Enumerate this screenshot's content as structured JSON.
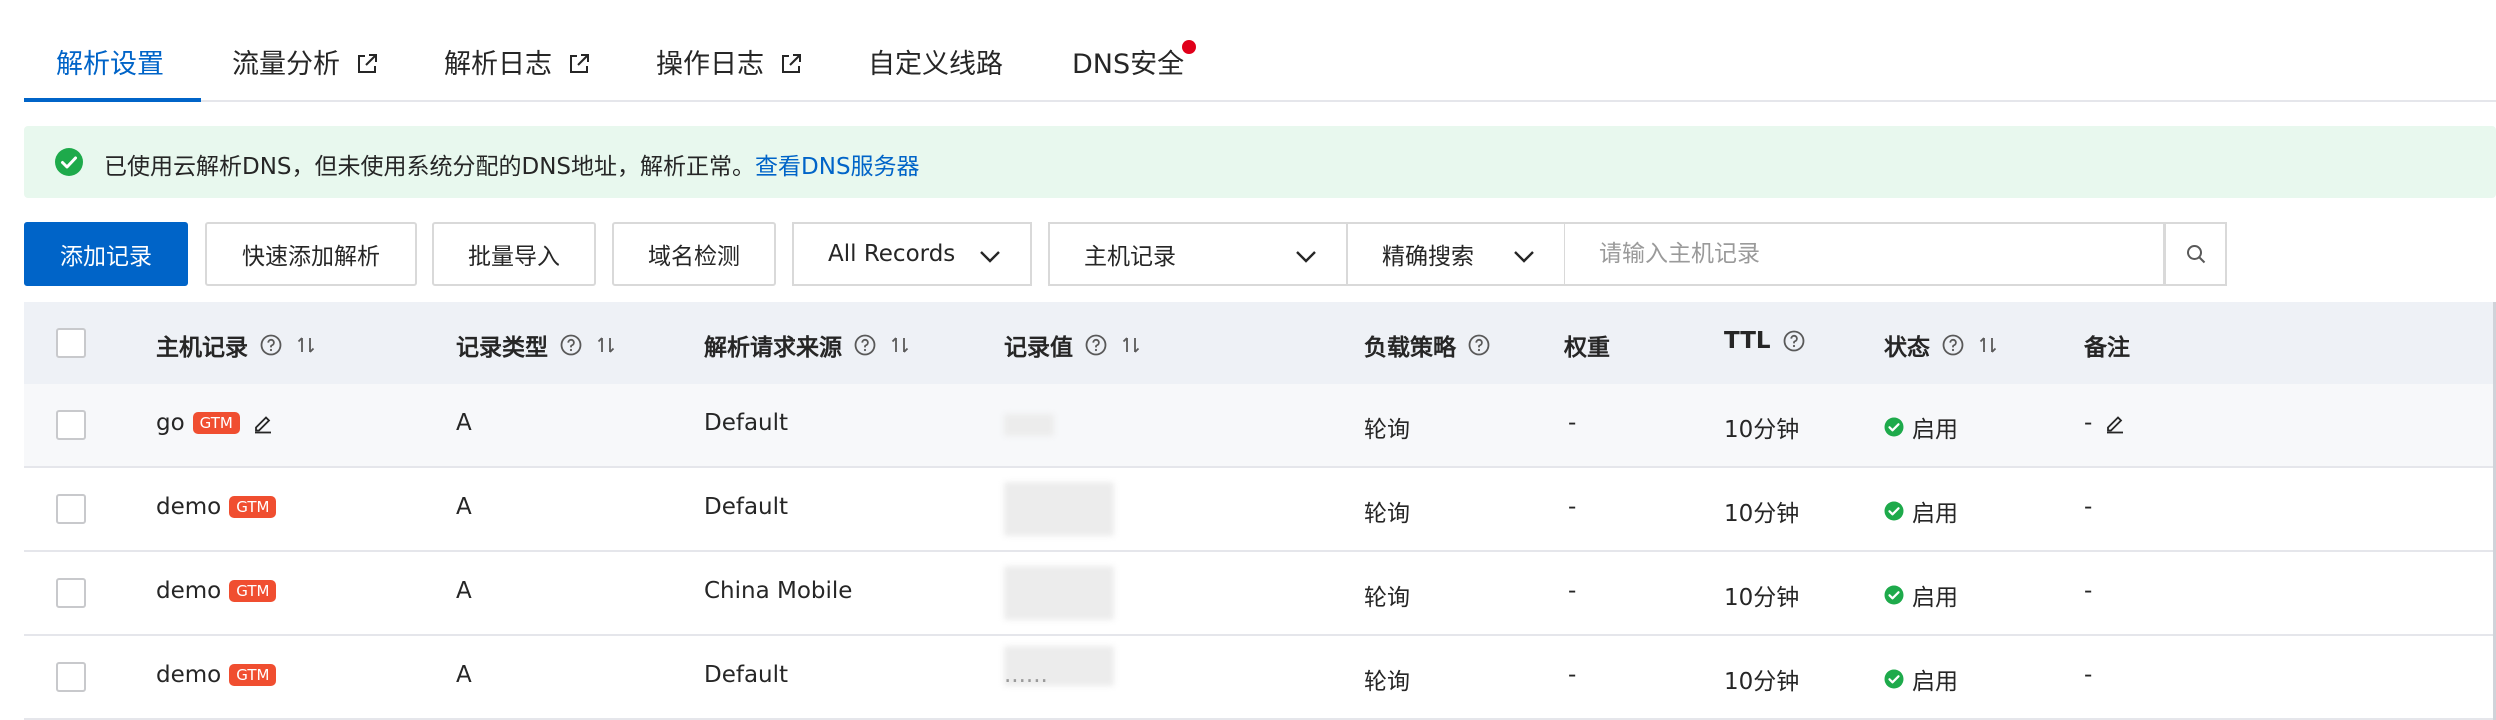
{
  "tabs": [
    {
      "label": "解析设置"
    },
    {
      "label": "流量分析"
    },
    {
      "label": "解析日志"
    },
    {
      "label": "操作日志"
    },
    {
      "label": "自定义线路"
    },
    {
      "label": "DNS安全"
    }
  ],
  "alert": {
    "text": "已使用云解析DNS，但未使用系统分配的DNS地址，解析正常。",
    "link": "查看DNS服务器"
  },
  "toolbar": {
    "add_record": "添加记录",
    "quick_add": "快速添加解析",
    "batch_import": "批量导入",
    "domain_check": "域名检测",
    "record_filter": "All Records",
    "search_field": "主机记录",
    "search_mode": "精确搜索",
    "search_placeholder": "请输入主机记录"
  },
  "table": {
    "headers": {
      "host": "主机记录",
      "type": "记录类型",
      "source": "解析请求来源",
      "value": "记录值",
      "policy": "负载策略",
      "weight": "权重",
      "ttl": "TTL",
      "status": "状态",
      "remark": "备注"
    },
    "gtm_badge": "GTM",
    "rows": [
      {
        "host": "go",
        "type": "A",
        "source": "Default",
        "value": "",
        "policy": "轮询",
        "weight": "-",
        "ttl": "10分钟",
        "status": "启用",
        "remark": "-"
      },
      {
        "host": "demo",
        "type": "A",
        "source": "Default",
        "value": "",
        "policy": "轮询",
        "weight": "-",
        "ttl": "10分钟",
        "status": "启用",
        "remark": "-"
      },
      {
        "host": "demo",
        "type": "A",
        "source": "China Mobile",
        "value": "",
        "policy": "轮询",
        "weight": "-",
        "ttl": "10分钟",
        "status": "启用",
        "remark": "-"
      },
      {
        "host": "demo",
        "type": "A",
        "source": "Default",
        "value": "......",
        "policy": "轮询",
        "weight": "-",
        "ttl": "10分钟",
        "status": "启用",
        "remark": "-"
      }
    ]
  },
  "colors": {
    "primary": "#0064c8",
    "success": "#1eaa4b",
    "gtm": "#f04e30",
    "alert_bg": "#e8f8ee",
    "notice_dot": "#e0001a"
  }
}
